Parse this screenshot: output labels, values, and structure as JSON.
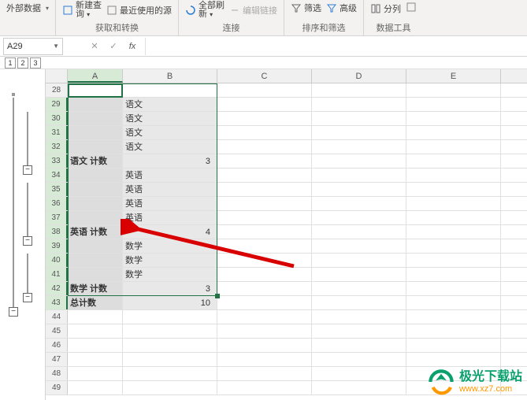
{
  "ribbon": {
    "group0_label": "外部数据",
    "group1": {
      "item1_a": "新建查",
      "item1_b": "询",
      "item2": "最近使用的源",
      "label": "获取和转换"
    },
    "group2": {
      "item1_a": "全部刷",
      "item1_b": "新",
      "item2": "编辑链接",
      "label": "连接"
    },
    "group3": {
      "item1": "筛选",
      "item2": "高级",
      "label": "排序和筛选"
    },
    "group4": {
      "item1": "分列",
      "label": "数据工具"
    }
  },
  "namebox": {
    "value": "A29"
  },
  "levels": [
    "1",
    "2",
    "3"
  ],
  "columns": [
    "A",
    "B",
    "C",
    "D",
    "E"
  ],
  "rows": [
    {
      "n": 28,
      "a": "",
      "b": "",
      "sel": false
    },
    {
      "n": 29,
      "a": "",
      "b": "语文",
      "sel": true
    },
    {
      "n": 30,
      "a": "",
      "b": "语文",
      "sel": true
    },
    {
      "n": 31,
      "a": "",
      "b": "语文",
      "sel": true
    },
    {
      "n": 32,
      "a": "",
      "b": "语文",
      "sel": true
    },
    {
      "n": 33,
      "a": "语文 计数",
      "b": "3",
      "sel": true,
      "bold": true,
      "num": true
    },
    {
      "n": 34,
      "a": "",
      "b": "英语",
      "sel": true
    },
    {
      "n": 35,
      "a": "",
      "b": "英语",
      "sel": true
    },
    {
      "n": 36,
      "a": "",
      "b": "英语",
      "sel": true
    },
    {
      "n": 37,
      "a": "",
      "b": "英语",
      "sel": true
    },
    {
      "n": 38,
      "a": "英语 计数",
      "b": "4",
      "sel": true,
      "bold": true,
      "num": true
    },
    {
      "n": 39,
      "a": "",
      "b": "数学",
      "sel": true
    },
    {
      "n": 40,
      "a": "",
      "b": "数学",
      "sel": true
    },
    {
      "n": 41,
      "a": "",
      "b": "数学",
      "sel": true
    },
    {
      "n": 42,
      "a": "数学 计数",
      "b": "3",
      "sel": true,
      "bold": true,
      "num": true
    },
    {
      "n": 43,
      "a": "总计数",
      "b": "10",
      "sel": true,
      "bold": true,
      "num": true
    },
    {
      "n": 44,
      "a": "",
      "b": "",
      "sel": false
    },
    {
      "n": 45,
      "a": "",
      "b": "",
      "sel": false
    },
    {
      "n": 46,
      "a": "",
      "b": "",
      "sel": false
    },
    {
      "n": 47,
      "a": "",
      "b": "",
      "sel": false
    },
    {
      "n": 48,
      "a": "",
      "b": "",
      "sel": false
    },
    {
      "n": 49,
      "a": "",
      "b": "",
      "sel": false
    }
  ],
  "watermark": {
    "t1": "极光下载站",
    "t2": "www.xz7.com"
  }
}
